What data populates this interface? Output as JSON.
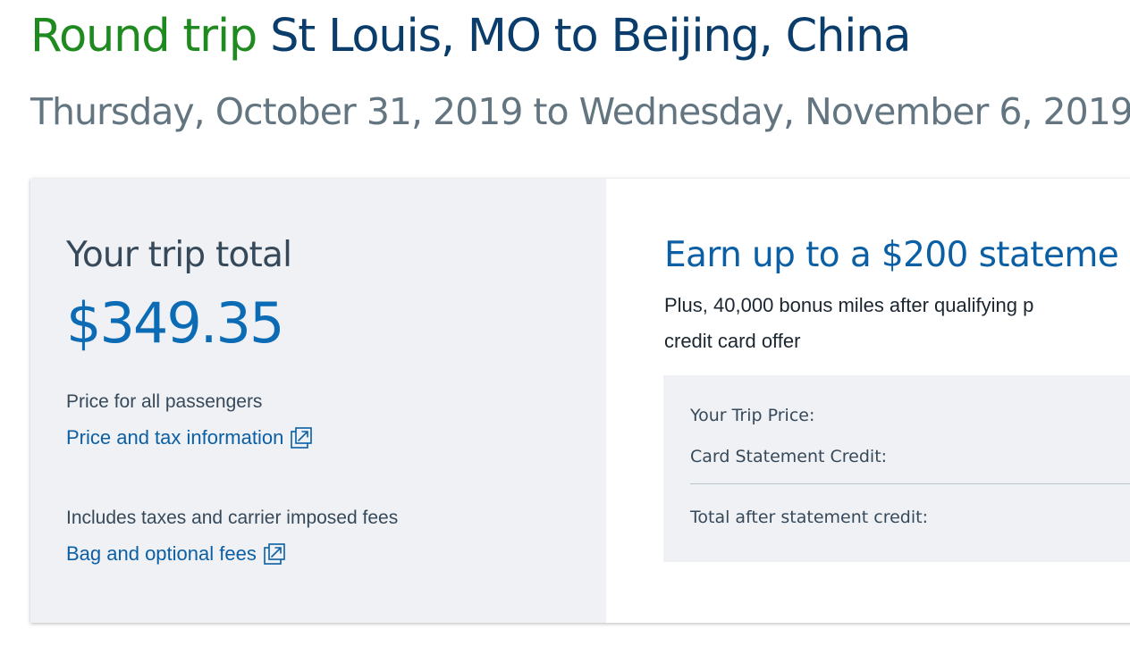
{
  "header": {
    "trip_type": "Round trip",
    "route": "St Louis, MO to Beijing, China",
    "dates": "Thursday, October 31, 2019 to Wednesday, November 6, 2019"
  },
  "summary": {
    "total_label": "Your trip total",
    "total_amount": "$349.35",
    "price_note": "Price for all passengers",
    "price_link": "Price and tax information",
    "fees_note": "Includes taxes and carrier imposed fees",
    "fees_link": "Bag and optional fees"
  },
  "offer": {
    "title": "Earn up to a $200 stateme",
    "subtitle_line1": "Plus, 40,000 bonus miles after qualifying p",
    "subtitle_line2": "credit card offer",
    "rows": {
      "trip_price": "Your Trip Price:",
      "statement_credit": "Card Statement Credit:",
      "total_after": "Total after statement credit:"
    }
  },
  "icons": {
    "external_link": "external-link-icon"
  },
  "colors": {
    "trip_type": "#1f8a1f",
    "route": "#0a3d6b",
    "dates": "#627580",
    "total_amount": "#0b6bb5",
    "link": "#0b5fa5",
    "panel_bg": "#f0f1f4"
  }
}
